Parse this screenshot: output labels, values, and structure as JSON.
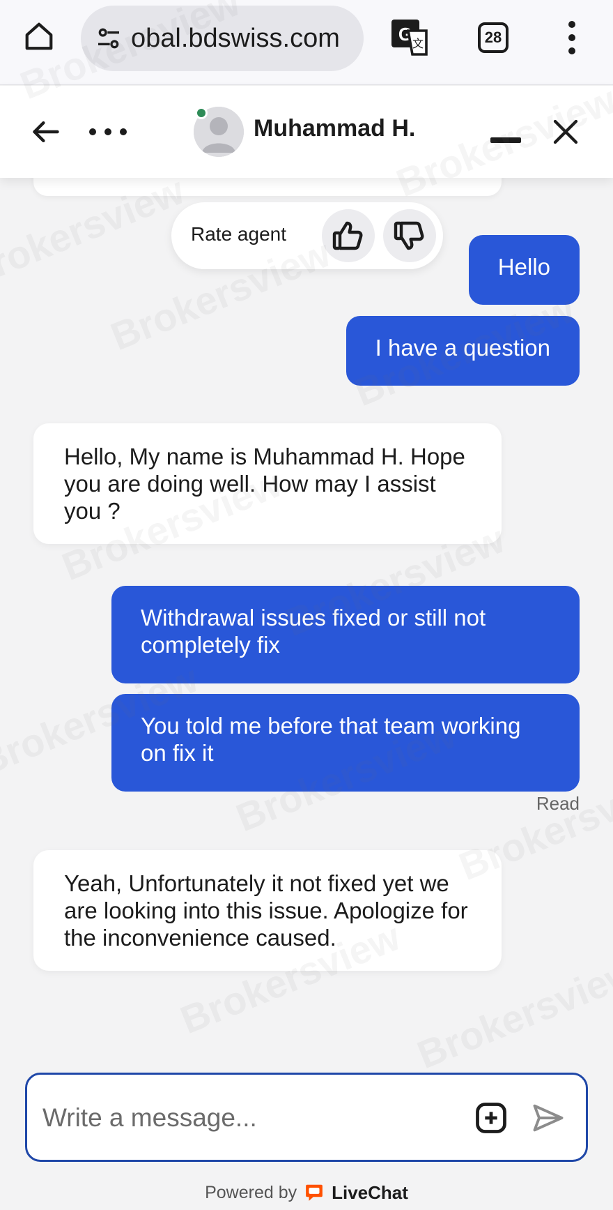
{
  "browser": {
    "url": "obal.bdswiss.com",
    "tab_count": "28"
  },
  "chat_header": {
    "agent_name": "Muhammad H."
  },
  "rate": {
    "label": "Rate agent"
  },
  "messages": [
    {
      "side": "out",
      "text": "Hello"
    },
    {
      "side": "out",
      "text": "I have a question"
    },
    {
      "side": "in",
      "text": "Hello, My name is Muhammad H. Hope you are doing well. How may I assist you ?"
    },
    {
      "side": "out",
      "text": "Withdrawal issues fixed or still not completely fix"
    },
    {
      "side": "out",
      "text": "You told me before that team working on fix it"
    },
    {
      "side": "in",
      "text": "Yeah, Unfortunately it not fixed yet we are looking into this issue. Apologize for the inconvenience caused."
    }
  ],
  "status": {
    "read": "Read"
  },
  "composer": {
    "placeholder": "Write a message..."
  },
  "footer": {
    "powered_by": "Powered by",
    "brand": "LiveChat"
  },
  "watermark": "Brokersview",
  "colors": {
    "outgoing_bubble": "#2957d8",
    "incoming_bubble": "#ffffff",
    "background": "#f3f3f4",
    "online": "#2e8b57",
    "composer_border": "#1f47a8",
    "livechat_brand": "#ff5100"
  }
}
